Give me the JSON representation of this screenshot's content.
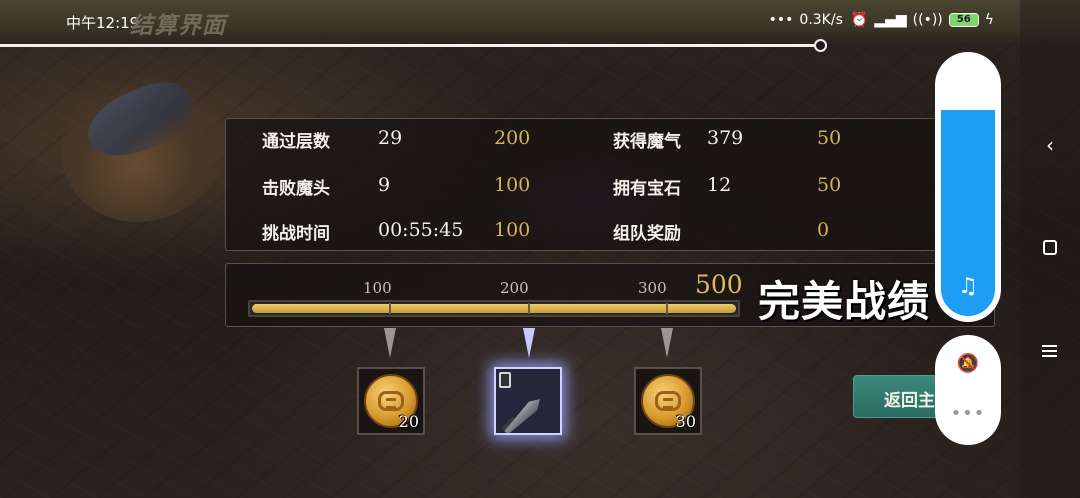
{
  "status_bar": {
    "time": "中午12:19",
    "net_speed": "0.3K/s",
    "battery": "56",
    "icons": [
      "dots-icon",
      "alarm-icon",
      "signal-icon",
      "wifi-icon",
      "battery-icon",
      "charging-icon"
    ]
  },
  "window_title": "结算界面",
  "stats": {
    "rows": [
      {
        "label": "通过层数",
        "value": "29",
        "points": "200"
      },
      {
        "label": "击败魔头",
        "value": "9",
        "points": "100"
      },
      {
        "label": "挑战时间",
        "value": "00:55:45",
        "points": "100"
      },
      {
        "label": "获得魔气",
        "value": "379",
        "points": "50"
      },
      {
        "label": "拥有宝石",
        "value": "12",
        "points": "50"
      },
      {
        "label": "组队奖励",
        "value": "",
        "points": "0"
      }
    ]
  },
  "score_bar": {
    "ticks": [
      "100",
      "200",
      "300"
    ],
    "max": "500",
    "fill_fraction": 1.0,
    "rating": "完美战绩"
  },
  "rewards": [
    {
      "type": "coin",
      "count": "20",
      "active": false
    },
    {
      "type": "dagger",
      "count": "",
      "active": true
    },
    {
      "type": "coin",
      "count": "30",
      "active": false
    }
  ],
  "return_button": "返回主",
  "volume_level": 0.8,
  "colors": {
    "gold": "#d9b25a",
    "teal_button": "#2a6a5e",
    "volume_blue": "#1e9df5"
  }
}
